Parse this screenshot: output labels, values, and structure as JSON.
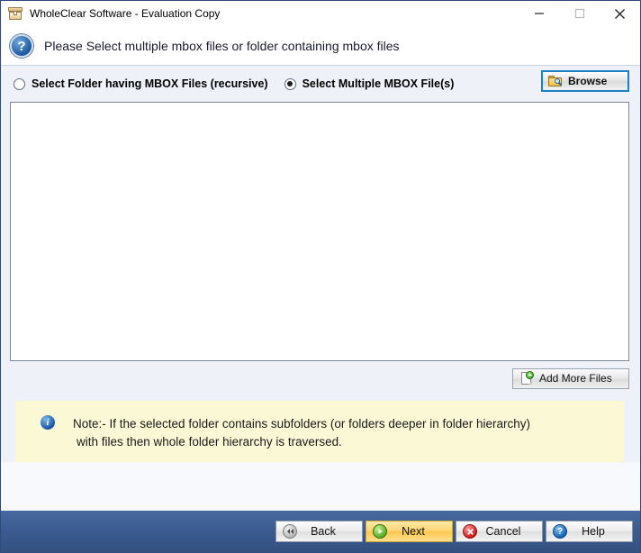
{
  "window": {
    "title": "WholeClear Software - Evaluation Copy",
    "app_icon": "archive-box-icon",
    "caption": {
      "minimize": "minimize-icon",
      "maximize": "maximize-icon",
      "close": "close-icon"
    }
  },
  "header": {
    "icon": "question-mark-icon",
    "icon_glyph": "?",
    "instruction": "Please Select multiple mbox files or folder containing mbox files"
  },
  "options": {
    "folder_option": {
      "label": "Select Folder having MBOX Files (recursive)",
      "selected": false
    },
    "files_option": {
      "label": "Select Multiple MBOX File(s)",
      "selected": true
    },
    "browse": {
      "label": "Browse",
      "icon": "folder-search-icon",
      "focused": true
    }
  },
  "file_list": {
    "items": [],
    "empty": ""
  },
  "add_more": {
    "label": "Add More Files",
    "icon": "file-add-icon"
  },
  "note": {
    "icon": "info-icon",
    "icon_glyph": "i",
    "line1": "Note:- If the selected folder contains subfolders (or folders deeper in folder hierarchy)",
    "line2": "with files then whole folder hierarchy is traversed."
  },
  "footer": {
    "buttons": [
      {
        "label": "Back",
        "icon": "rewind-icon",
        "style": "normal"
      },
      {
        "label": "Next",
        "icon": "play-icon",
        "style": "primary"
      },
      {
        "label": "Cancel",
        "icon": "cancel-icon",
        "style": "normal"
      },
      {
        "label": "Help",
        "icon": "help-icon",
        "style": "normal"
      }
    ]
  },
  "colors": {
    "footer_blue": "#3a5a8e",
    "body_bg": "#eef1f8",
    "note_bg": "#fbf8d5",
    "focus_border": "#1b7fc4",
    "next_yellow": "#ffd470"
  }
}
